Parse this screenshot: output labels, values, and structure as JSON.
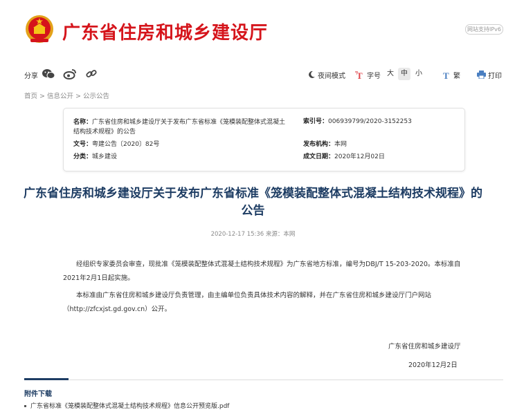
{
  "site": {
    "title": "广东省住房和城乡建设厅",
    "ipv6_badge": "网站支持IPv6",
    "brand_color": "#d5141b"
  },
  "toolbar": {
    "share_label": "分享",
    "share_icons": [
      "wechat-icon",
      "weibo-icon",
      "link-icon"
    ],
    "night_mode": "夜间模式",
    "font_size_label": "字号",
    "sizes": [
      "大",
      "中",
      "小"
    ],
    "active_size": "中",
    "traditional": "繁",
    "print": "打印"
  },
  "breadcrumb": "首页 > 信息公开 > 公示公告",
  "info": {
    "name_key": "名称：",
    "name_value": "广东省住房和城乡建设厅关于发布广东省标准《笼模装配整体式混凝土结构技术规程》的公告",
    "index_key": "索引号：",
    "index_value": "006939799/2020-3152253",
    "doc_no_key": "文号：",
    "doc_no_value": "粤建公告〔2020〕82号",
    "issuer_key": "发布机构：",
    "issuer_value": "本网",
    "category_key": "分类：",
    "category_value": "城乡建设",
    "date_key": "成文日期：",
    "date_value": "2020年12月02日"
  },
  "article": {
    "title": "广东省住房和城乡建设厅关于发布广东省标准《笼模装配整体式混凝土结构技术规程》的公告",
    "meta": "2020-12-17  15:36    来源：本网",
    "para1": "经组织专家委员会审查，现批准《笼模装配整体式混凝土结构技术规程》为广东省地方标准，编号为DBJ/T 15-203-2020。本标准自2021年2月1日起实施。",
    "para2": "本标准由广东省住房和城乡建设厅负责管理，由主编单位负责具体技术内容的解释，并在广东省住房和城乡建设厅门户网站（http://zfcxjst.gd.gov.cn）公开。",
    "sign_org": "广东省住房和城乡建设厅",
    "sign_date": "2020年12月2日"
  },
  "attachments": {
    "title": "附件下载",
    "items": [
      "广东省标准《笼模装配整体式混凝土结构技术规程》信息公开预览版.pdf"
    ]
  },
  "colors": {
    "title_blue": "#1d3c63",
    "icon_red": "#e0464c",
    "icon_blue": "#4a7fc1"
  }
}
